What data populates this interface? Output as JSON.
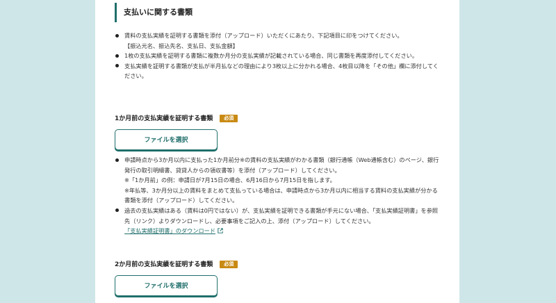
{
  "section": {
    "title": "支払いに関する書類",
    "bullets": [
      {
        "text": "賃料の支払実績を証明する書類を添付（アップロード）いただくにあたり、下記項目に印をつけてください。",
        "note": "【振込元名、振込先名、支払日、支払金額】"
      },
      {
        "text": "1枚の支払実績を証明する書類に複数か月分の支払実績が記載されている場合、同じ書類を再度添付してください。"
      },
      {
        "text": "支払実績を証明する書類が支払が半月払などの理由により3枚以上に分かれる場合、4枚目以降を「その他」欄に添付してください。"
      }
    ]
  },
  "item1": {
    "title": "1か月前の支払実績を証明する書類",
    "badge": "必須",
    "button": "ファイルを選択",
    "bullets": [
      {
        "text": "申請時点から3か月以内に支払った1か月前分※の賃料の支払実績がわかる書類（銀行通帳（Web通帳含む）のページ、銀行発行の取引明細書、貸貸人からの領収書等）を添付（アップロード）してください。",
        "note1": "※「1か月前」の例：申請日が7月15日の場合、6月16日から7月15日を指します。",
        "note2": "※年払等、3か月分以上の賃料をまとめて支払っている場合は、申請時点から3か月以内に相当する賃料の支払実績が分かる書類を添付（アップロード）してください。"
      },
      {
        "text": "過去の支払実績はある（賃料は0円ではない）が、支払実績を証明できる書類が手元にない場合、「支払実績証明書」を参照先（リンク）よりダウンロードし、必要事項をご記入の上、添付（アップロード）してください。",
        "link": "「支払実績証明書」のダウンロード"
      }
    ]
  },
  "item2": {
    "title": "2か月前の支払実績を証明する書類",
    "badge": "必須",
    "button": "ファイルを選択"
  },
  "colors": {
    "accent": "#1f6f6b",
    "badge": "#c98a14",
    "background": "#cfe6e8"
  }
}
